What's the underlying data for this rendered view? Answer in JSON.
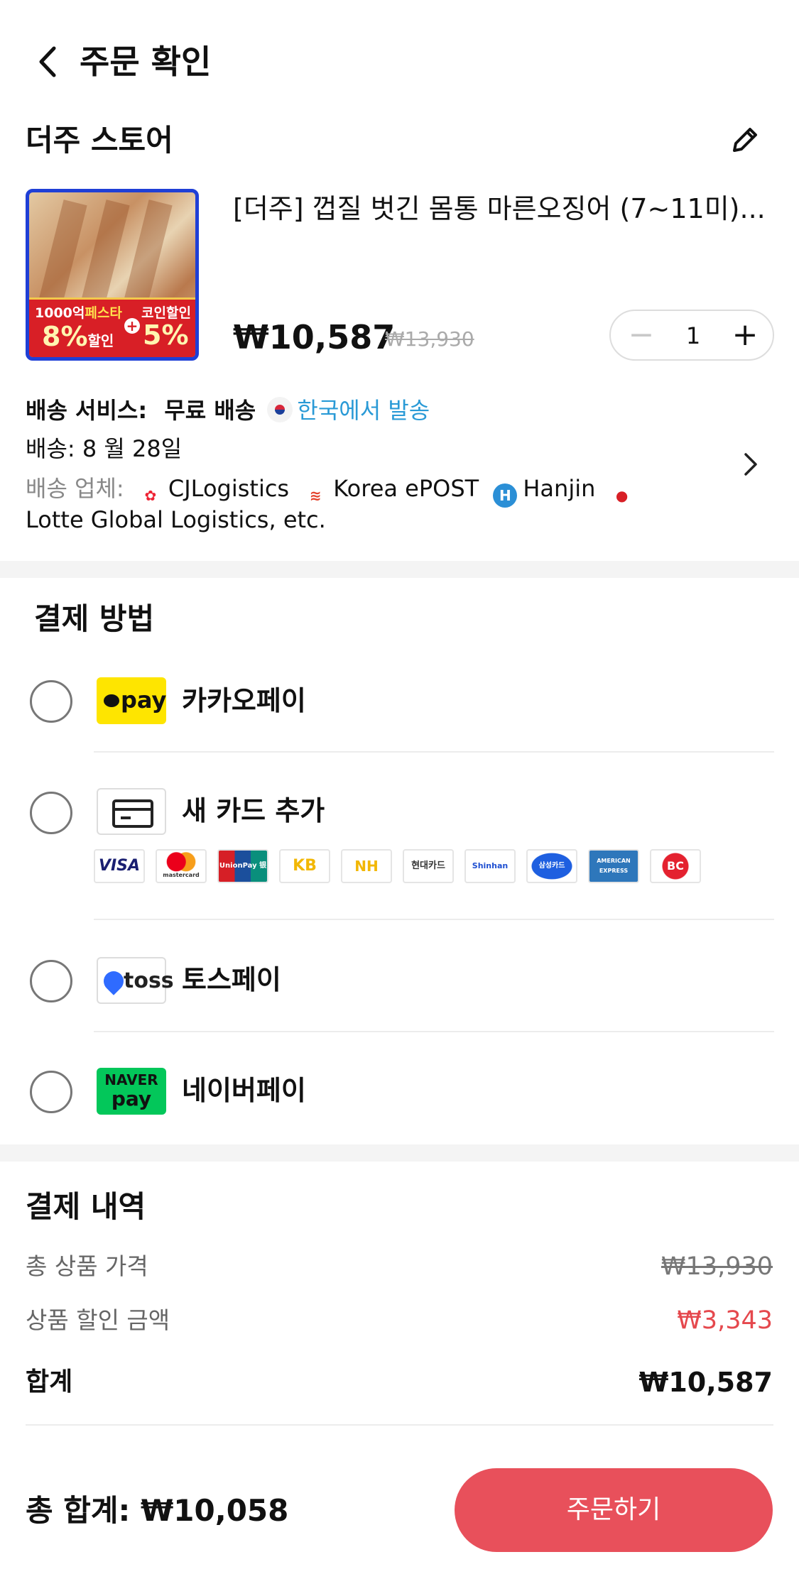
{
  "header": {
    "title": "주문 확인"
  },
  "store": {
    "name": "더주 스토어"
  },
  "product": {
    "title": "[더주] 껍질 벗긴 몸통 마른오징어 (7~11미)...",
    "price": "₩10,587",
    "original_price": "₩13,930",
    "quantity": "1",
    "thumb_promo": {
      "line1a": "1000억",
      "line1b": "페스타",
      "big1": "8%",
      "big1_suffix": "할인",
      "line2": "코인할인",
      "big2": "5%"
    }
  },
  "shipping": {
    "service_label": "배송 서비스:",
    "service_value": "무료 배송",
    "origin": "한국에서 발송",
    "delivery": "배송: 8 월 28일",
    "carriers_label": "배송 업체:",
    "carriers": [
      "CJLogistics",
      "Korea ePOST",
      "Hanjin"
    ],
    "carriers_more": "Lotte Global Logistics, etc."
  },
  "payment": {
    "title": "결제 방법",
    "methods": [
      {
        "label": "카카오페이",
        "icon": "kakaopay-icon",
        "icon_text": "pay"
      },
      {
        "label": "새 카드 추가",
        "icon": "card-icon"
      },
      {
        "label": "토스페이",
        "icon": "toss-icon",
        "icon_text": "toss"
      },
      {
        "label": "네이버페이",
        "icon": "naverpay-icon",
        "icon_text_1": "NAVER",
        "icon_text_2": "pay"
      }
    ],
    "card_brands": [
      "VISA",
      "mastercard",
      "UnionPay 银联",
      "KB",
      "NH",
      "현대카드",
      "Shinhan",
      "삼성카드",
      "AMERICAN EXPRESS",
      "BC"
    ]
  },
  "summary": {
    "title": "결제 내역",
    "rows": [
      {
        "label": "총 상품 가격",
        "value": "₩13,930"
      },
      {
        "label": "상품 할인 금액",
        "value": "₩3,343"
      }
    ],
    "total_label": "합계",
    "total_value": "₩10,587"
  },
  "footer": {
    "total_text": "총 합계: ₩10,058",
    "order_button": "주문하기"
  },
  "colors": {
    "accent": "#e8505b",
    "discount": "#e5484d",
    "link": "#2a9ad6"
  }
}
